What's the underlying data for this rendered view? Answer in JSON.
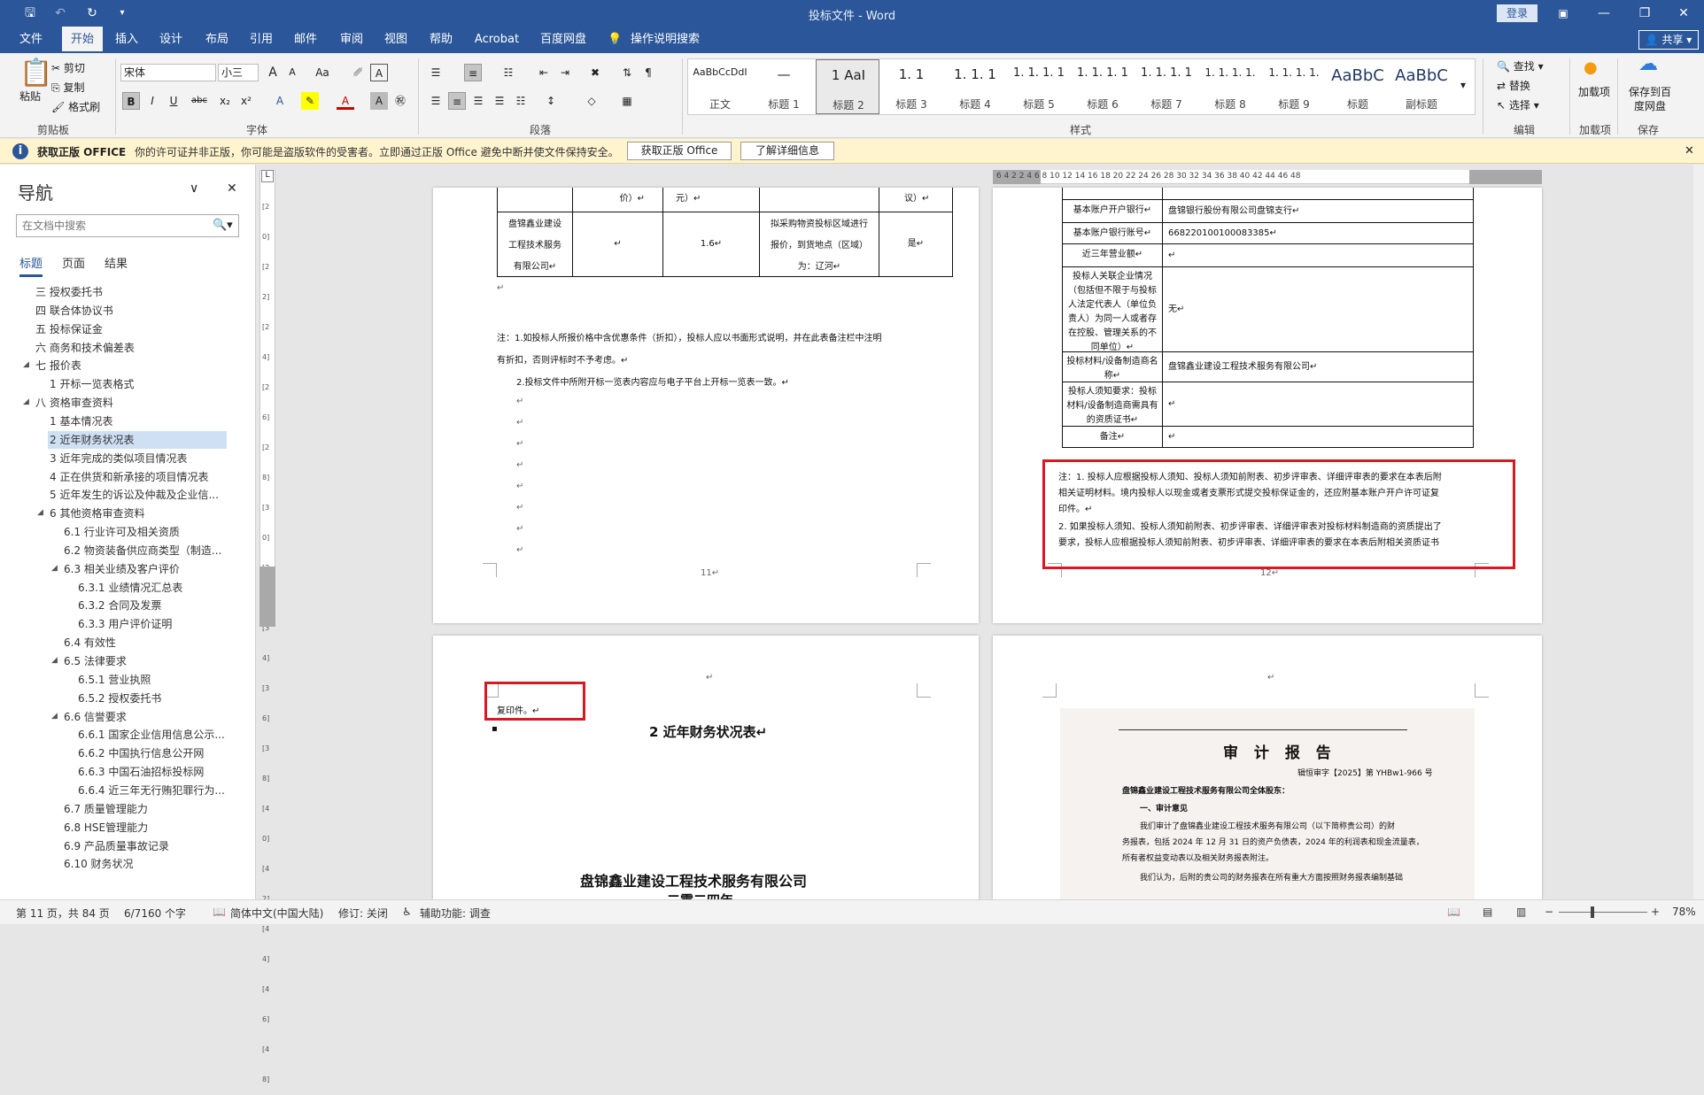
{
  "titlebar": {
    "title": "投标文件 - Word",
    "login": "登录"
  },
  "tabs": [
    "文件",
    "开始",
    "插入",
    "设计",
    "布局",
    "引用",
    "邮件",
    "审阅",
    "视图",
    "帮助",
    "Acrobat",
    "百度网盘"
  ],
  "search_hint": "操作说明搜索",
  "share": "共享",
  "ribbon": {
    "clipboard": {
      "paste": "粘贴",
      "cut": "剪切",
      "copy": "复制",
      "format_painter": "格式刷",
      "label": "剪贴板"
    },
    "font": {
      "name": "宋体",
      "size": "小三",
      "label": "字体",
      "bold": "B",
      "italic": "I",
      "underline": "U",
      "strike": "abc",
      "sub": "x₂",
      "sup": "x²",
      "grow": "A",
      "shrink": "A",
      "case": "Aa"
    },
    "paragraph": {
      "label": "段落"
    },
    "styles": {
      "label": "样式",
      "items": [
        {
          "preview": "AaBbCcDdI",
          "name": "正文"
        },
        {
          "preview": "—",
          "name": "标题 1"
        },
        {
          "preview": "1 AaI",
          "name": "标题 2"
        },
        {
          "preview": "1. 1",
          "name": "标题 3"
        },
        {
          "preview": "1. 1. 1",
          "name": "标题 4"
        },
        {
          "preview": "1. 1. 1. 1",
          "name": "标题 5"
        },
        {
          "preview": "1. 1. 1. 1",
          "name": "标题 6"
        },
        {
          "preview": "1. 1. 1. 1",
          "name": "标题 7"
        },
        {
          "preview": "1. 1. 1. 1.",
          "name": "标题 8"
        },
        {
          "preview": "1. 1. 1. 1.",
          "name": "标题 9"
        },
        {
          "preview": "AaBbC",
          "name": "标题"
        },
        {
          "preview": "AaBbC",
          "name": "副标题"
        }
      ]
    },
    "editing": {
      "find": "查找",
      "replace": "替换",
      "select": "选择",
      "label": "编辑"
    },
    "addins": {
      "btn": "加载项",
      "label": "加载项"
    },
    "save": {
      "btn": "保存到百度网盘",
      "label": "保存"
    }
  },
  "infobar": {
    "bold": "获取正版 OFFICE",
    "message": "你的许可证并非正版，你可能是盗版软件的受害者。立即通过正版 Office 避免中断并使文件保持安全。",
    "btn1": "获取正版 Office",
    "btn2": "了解详细信息"
  },
  "nav": {
    "title": "导航",
    "search_placeholder": "在文档中搜索",
    "tabs": [
      "标题",
      "页面",
      "结果"
    ],
    "items": [
      {
        "text": "三 授权委托书",
        "level": 1
      },
      {
        "text": "四 联合体协议书",
        "level": 1
      },
      {
        "text": "五 投标保证金",
        "level": 1
      },
      {
        "text": "六 商务和技术偏差表",
        "level": 1
      },
      {
        "text": "七 报价表",
        "level": 1,
        "open": true
      },
      {
        "text": "1 开标一览表格式",
        "level": 2
      },
      {
        "text": "八 资格审查资料",
        "level": 1,
        "open": true
      },
      {
        "text": "1 基本情况表",
        "level": 2
      },
      {
        "text": "2 近年财务状况表",
        "level": 2,
        "selected": true
      },
      {
        "text": "3 近年完成的类似项目情况表",
        "level": 2
      },
      {
        "text": "4 正在供货和新承接的项目情况表",
        "level": 2
      },
      {
        "text": "5 近年发生的诉讼及仲裁及企业信...",
        "level": 2
      },
      {
        "text": "6 其他资格审查资料",
        "level": 2,
        "open": true
      },
      {
        "text": "6.1 行业许可及相关资质",
        "level": 3
      },
      {
        "text": "6.2 物资装备供应商类型（制造...",
        "level": 3
      },
      {
        "text": "6.3 相关业绩及客户评价",
        "level": 3,
        "open": true
      },
      {
        "text": "6.3.1 业绩情况汇总表",
        "level": 4
      },
      {
        "text": "6.3.2 合同及发票",
        "level": 4
      },
      {
        "text": "6.3.3 用户评价证明",
        "level": 4
      },
      {
        "text": "6.4 有效性",
        "level": 3
      },
      {
        "text": "6.5 法律要求",
        "level": 3,
        "open": true
      },
      {
        "text": "6.5.1 营业执照",
        "level": 4
      },
      {
        "text": "6.5.2 授权委托书",
        "level": 4
      },
      {
        "text": "6.6 信誉要求",
        "level": 3,
        "open": true
      },
      {
        "text": "6.6.1 国家企业信用信息公示...",
        "level": 4
      },
      {
        "text": "6.6.2 中国执行信息公开网",
        "level": 4
      },
      {
        "text": "6.6.3 中国石油招标投标网",
        "level": 4
      },
      {
        "text": "6.6.4 近三年无行贿犯罪行为...",
        "level": 4
      },
      {
        "text": "6.7 质量管理能力",
        "level": 3
      },
      {
        "text": "6.8 HSE管理能力",
        "level": 3
      },
      {
        "text": "6.9 产品质量事故记录",
        "level": 3
      },
      {
        "text": "6.10 财务状况",
        "level": 3
      }
    ]
  },
  "vruler": "[20] [22] [24] [26] [28] [30] [32] [34] [36] [38] [40] [42] [44] [46] [48]",
  "hruler": "6 4 2 2 4 6 8 10 12 14 16 18 20 22 24 26 28 30 32 34 36 38 40 42 44 46 48",
  "page11": {
    "row_top": [
      "价）↵",
      "元）↵",
      "议）↵"
    ],
    "company": [
      "盘锦鑫业建设",
      "工程技术服务",
      "有限公司↵"
    ],
    "price": "1.6↵",
    "place": [
      "拟采购物资投标区域进行",
      "报价，到货地点（区域）",
      "为：辽河↵"
    ],
    "yes": "是↵",
    "note1": "注：1.如投标人所报价格中含优惠条件（折扣），投标人应以书面形式说明，并在此表备注栏中注明",
    "note1b": "有折扣，否则评标时不予考虑。↵",
    "note2": "2.投标文件中所附开标一览表内容应与电子平台上开标一览表一致。↵",
    "pagenum": "11↵"
  },
  "page12": {
    "rows": [
      {
        "label": "基本账户开户银行↵",
        "value": "盘锦银行股份有限公司盘锦支行↵"
      },
      {
        "label": "基本账户银行账号↵",
        "value": "668220100100083385↵"
      },
      {
        "label": "近三年营业额↵",
        "value": "↵"
      },
      {
        "label": "投标人关联企业情况（包括但不限于与投标人法定代表人（单位负责人）为同一人或者存在控股、管理关系的不同单位）↵",
        "value": "无↵"
      },
      {
        "label": "投标材料/设备制造商名称↵",
        "value": "盘锦鑫业建设工程技术服务有限公司↵"
      },
      {
        "label": "投标人须知要求：投标材料/设备制造商需具有的资质证书↵",
        "value": "↵"
      },
      {
        "label": "备注↵",
        "value": "↵"
      }
    ],
    "note1": "注：1. 投标人应根据投标人须知、投标人须知前附表、初步评审表、详细评审表的要求在本表后附",
    "note1b": "相关证明材料。境内投标人以现金或者支票形式提交投标保证金的，还应附基本账户开户许可证复",
    "note1c": "印件。↵",
    "note2": "2. 如果投标人须知、投标人须知前附表、初步评审表、详细评审表对投标材料制造商的资质提出了",
    "note2b": "要求，投标人应根据投标人须知前附表、初步评审表、详细评审表的要求在本表后附相关资质证书",
    "pagenum": "12↵"
  },
  "page13": {
    "carry": "复印件。↵",
    "heading": "2  近年财务状况表↵",
    "company": "盘锦鑫业建设工程技术服务有限公司",
    "year": "二零二四年"
  },
  "page14": {
    "title": "审 计 报 告",
    "ref": "辑恒审字【2025】第 YHBw1-966 号",
    "to": "盘锦鑫业建设工程技术服务有限公司全体股东：",
    "sec": "一、审计意见",
    "p1": "我们审计了盘锦鑫业建设工程技术服务有限公司（以下简称贵公司）的财",
    "p2": "务报表，包括 2024 年 12 月 31 日的资产负债表，2024 年的利润表和现金流量表，",
    "p3": "所有者权益变动表以及相关财务报表附注。",
    "p4": "我们认为，后附的贵公司的财务报表在所有重大方面按照财务报表编制基础"
  },
  "status": {
    "page": "第 11 页，共 84 页",
    "words": "6/7160 个字",
    "lang": "简体中文(中国大陆)",
    "track": "修订: 关闭",
    "access": "辅助功能: 调查",
    "zoom": "78%"
  }
}
